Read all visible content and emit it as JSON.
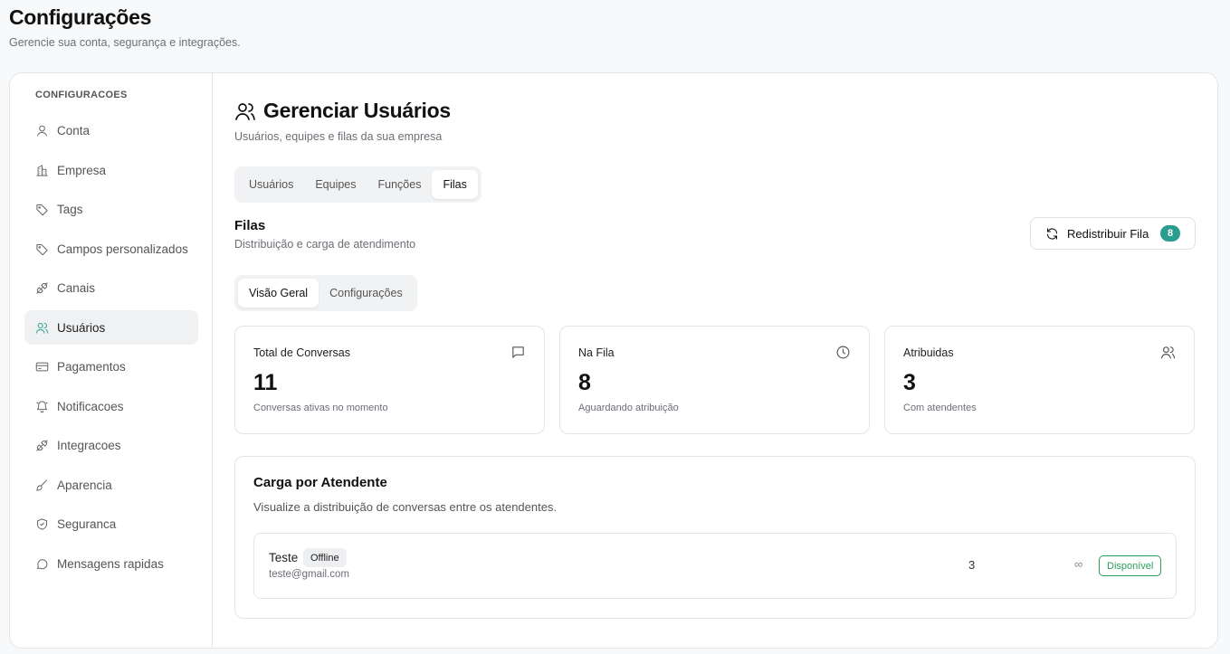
{
  "page": {
    "title": "Configurações",
    "subtitle": "Gerencie sua conta, segurança e integrações."
  },
  "sidebar": {
    "heading": "CONFIGURACOES",
    "items": [
      {
        "label": "Conta",
        "icon": "user-icon"
      },
      {
        "label": "Empresa",
        "icon": "building-icon"
      },
      {
        "label": "Tags",
        "icon": "tag-icon"
      },
      {
        "label": "Campos personalizados",
        "icon": "tag-icon"
      },
      {
        "label": "Canais",
        "icon": "plug-icon"
      },
      {
        "label": "Usuários",
        "icon": "users-icon",
        "active": true
      },
      {
        "label": "Pagamentos",
        "icon": "credit-card-icon"
      },
      {
        "label": "Notificacoes",
        "icon": "bell-icon"
      },
      {
        "label": "Integracoes",
        "icon": "plug-icon"
      },
      {
        "label": "Aparencia",
        "icon": "brush-icon"
      },
      {
        "label": "Seguranca",
        "icon": "shield-icon"
      },
      {
        "label": "Mensagens rapidas",
        "icon": "message-circle-icon"
      }
    ]
  },
  "section": {
    "title": "Gerenciar Usuários",
    "subtitle": "Usuários, equipes e filas da sua empresa"
  },
  "tabs": [
    {
      "label": "Usuários"
    },
    {
      "label": "Equipes"
    },
    {
      "label": "Funções"
    },
    {
      "label": "Filas",
      "active": true
    }
  ],
  "filas": {
    "title": "Filas",
    "subtitle": "Distribuição e carga de atendimento",
    "redistribute_label": "Redistribuir Fila",
    "redistribute_count": "8"
  },
  "subtabs": [
    {
      "label": "Visão Geral",
      "active": true
    },
    {
      "label": "Configurações"
    }
  ],
  "stats": [
    {
      "label": "Total de Conversas",
      "value": "11",
      "desc": "Conversas ativas no momento",
      "icon": "message-square-icon"
    },
    {
      "label": "Na Fila",
      "value": "8",
      "desc": "Aguardando atribuição",
      "icon": "clock-icon"
    },
    {
      "label": "Atribuidas",
      "value": "3",
      "desc": "Com atendentes",
      "icon": "users-icon"
    }
  ],
  "carga": {
    "title": "Carga por Atendente",
    "subtitle": "Visualize a distribuição de conversas entre os atendentes.",
    "agents": [
      {
        "name": "Teste",
        "status": "Offline",
        "email": "teste@gmail.com",
        "count": "3",
        "limit": "∞",
        "availability": "Disponível"
      }
    ]
  },
  "colors": {
    "accent": "#2a9d8f",
    "available": "#2a9d5a"
  }
}
